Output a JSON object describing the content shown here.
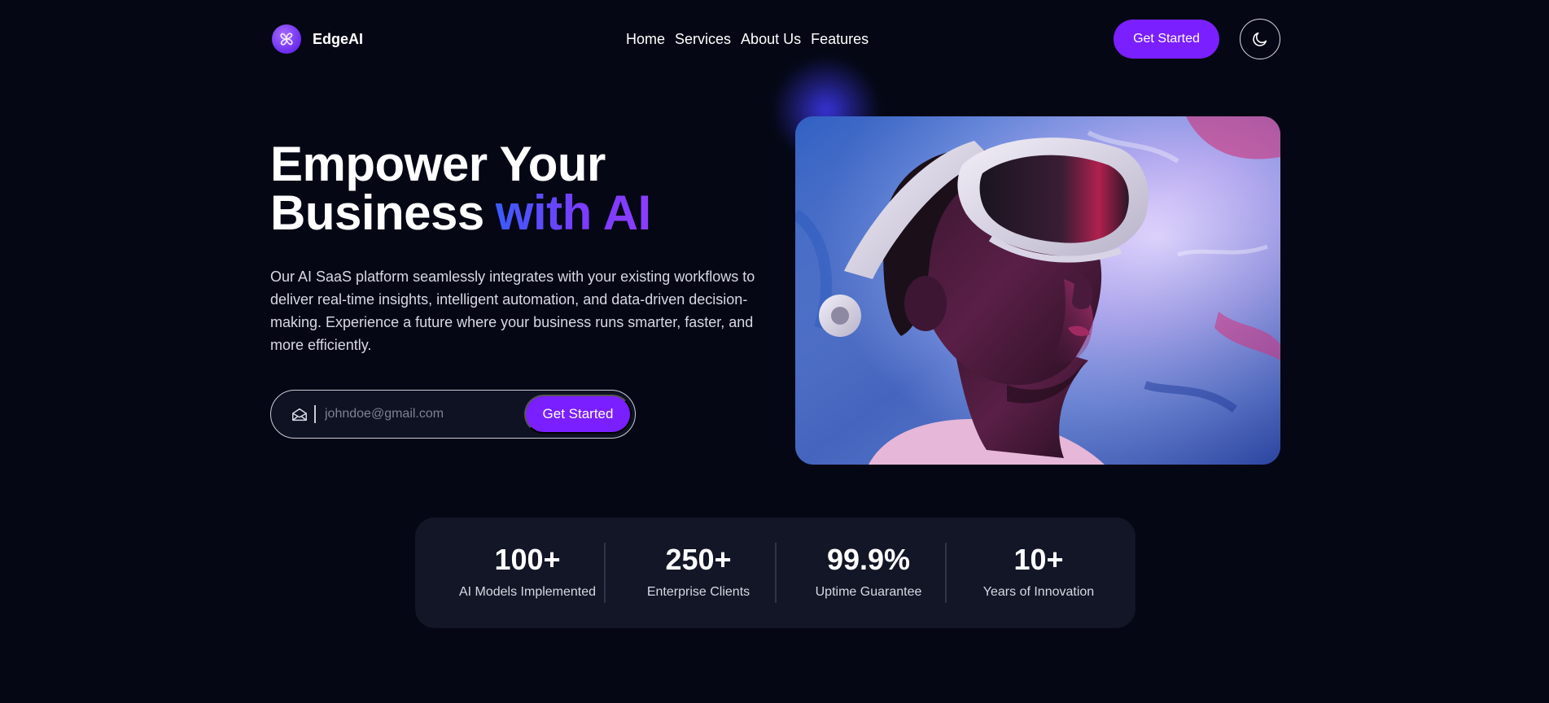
{
  "brand": {
    "name": "EdgeAI",
    "logo_icon": "pinwheel-logo-icon",
    "accent_color": "#7a1fff"
  },
  "nav": {
    "links": [
      "Home",
      "Services",
      "About Us",
      "Features"
    ],
    "cta_label": "Get Started",
    "theme_toggle_icon": "moon-icon"
  },
  "hero": {
    "title_line1": "Empower Your",
    "title_line2": "Business",
    "title_accent": "with AI",
    "description": "Our AI SaaS platform seamlessly integrates with your existing workflows to deliver real-time insights, intelligent automation, and data-driven decision-making. Experience a future where your business runs smarter, faster, and more efficiently.",
    "email_placeholder": "johndoe@gmail.com",
    "email_value": "",
    "email_icon": "envelope-open-icon",
    "signup_button_label": "Get Started",
    "image_subject": "person-wearing-vr-headset"
  },
  "stats": [
    {
      "value": "100+",
      "label": "AI Models Implemented"
    },
    {
      "value": "250+",
      "label": "Enterprise Clients"
    },
    {
      "value": "99.9%",
      "label": "Uptime Guarantee"
    },
    {
      "value": "10+",
      "label": "Years of Innovation"
    }
  ]
}
